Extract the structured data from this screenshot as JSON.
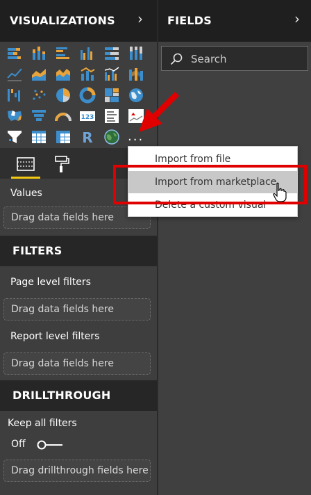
{
  "visualizations": {
    "title": "VISUALIZATIONS",
    "more_label": "...",
    "icons": [
      "stacked-bar-chart-icon",
      "stacked-column-chart-icon",
      "clustered-bar-chart-icon",
      "clustered-column-chart-icon",
      "100-percent-stacked-bar-icon",
      "100-percent-stacked-column-icon",
      "line-chart-icon",
      "area-chart-icon",
      "stacked-area-chart-icon",
      "line-and-stacked-column-icon",
      "line-and-clustered-column-icon",
      "ribbon-chart-icon",
      "waterfall-chart-icon",
      "scatter-chart-icon",
      "pie-chart-icon",
      "donut-chart-icon",
      "treemap-icon",
      "map-icon",
      "filled-map-icon",
      "funnel-icon",
      "gauge-icon",
      "card-icon",
      "multi-row-card-icon",
      "kpi-icon",
      "slicer-icon",
      "table-icon",
      "matrix-icon",
      "r-visual-icon",
      "globe-map-icon"
    ],
    "r_label": "R",
    "card_label": "123",
    "tabs": [
      "fields-tab",
      "format-tab"
    ]
  },
  "values": {
    "label": "Values",
    "drop_text": "Drag data fields here"
  },
  "filters": {
    "title": "FILTERS",
    "page_label": "Page level filters",
    "page_drop": "Drag data fields here",
    "report_label": "Report level filters",
    "report_drop": "Drag data fields here"
  },
  "drillthrough": {
    "title": "DRILLTHROUGH",
    "keep_filters_label": "Keep all filters",
    "toggle_label": "Off",
    "drop_text": "Drag drillthrough fields here"
  },
  "fields": {
    "title": "FIELDS",
    "search_placeholder": "Search"
  },
  "context_menu": {
    "items": [
      "Import from file",
      "Import from marketplace",
      "Delete a custom visual"
    ],
    "hovered_index": 1
  },
  "colors": {
    "accent_yellow": "#f2c811",
    "chart_blue": "#3c8dcb",
    "chart_orange": "#e8a33b",
    "highlight_red": "#e00000"
  }
}
